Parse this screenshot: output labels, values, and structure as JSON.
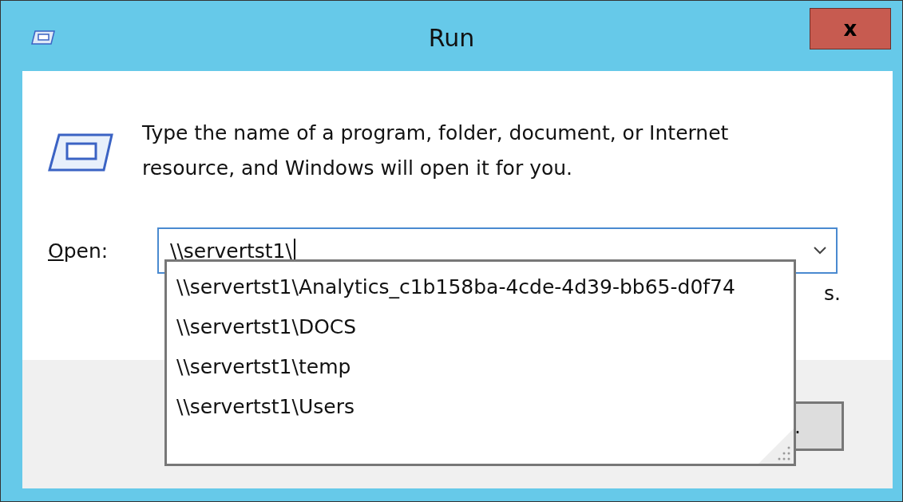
{
  "window": {
    "title": "Run",
    "close": "x"
  },
  "message": "Type the name of a program, folder, document, or Internet resource, and Windows will open it for you.",
  "open_field": {
    "label": "Open:",
    "value": "\\\\servertst1\\"
  },
  "suggestions": [
    {
      "text": "\\\\servertst1\\Analytics_c1b158ba-4cde-4d39-bb65-d0f74",
      "selected": false
    },
    {
      "text": "\\\\servertst1\\DOCS",
      "selected": false
    },
    {
      "text": "\\\\servertst1\\temp",
      "selected": false
    },
    {
      "text": "\\\\servertst1\\Users",
      "selected": false
    }
  ],
  "hidden_note": "s.",
  "hidden_button": "."
}
